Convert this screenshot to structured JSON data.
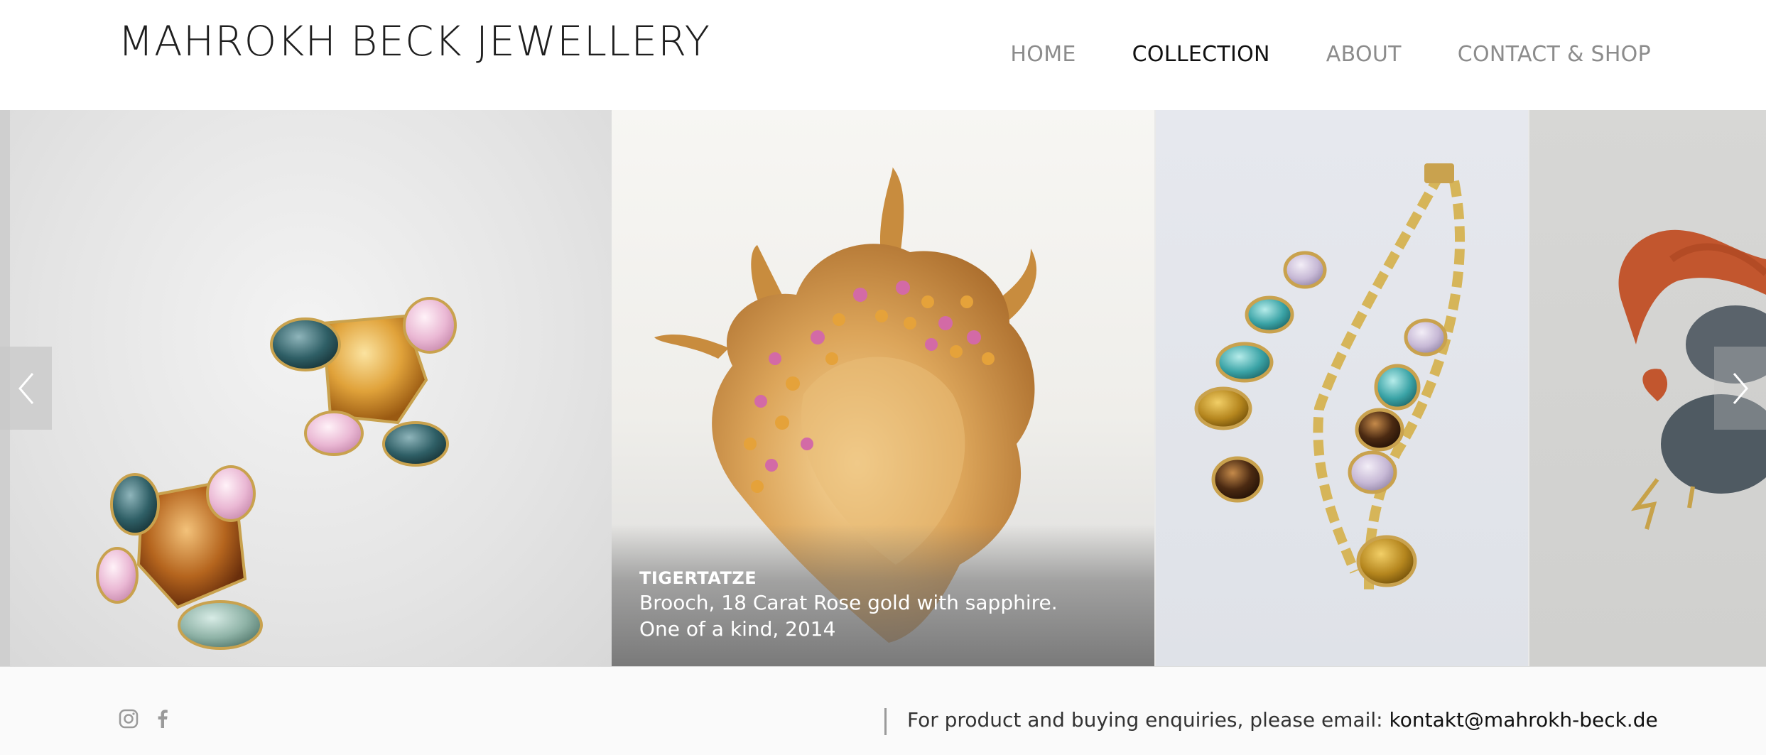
{
  "header": {
    "brand": "MAHROKH BECK JEWELLERY",
    "nav": [
      {
        "label": "HOME",
        "active": false
      },
      {
        "label": "COLLECTION",
        "active": true
      },
      {
        "label": "ABOUT",
        "active": false
      },
      {
        "label": "CONTACT & SHOP",
        "active": false
      }
    ]
  },
  "gallery": {
    "caption": {
      "title": "TIGERTATZE",
      "line1": "Brooch, 18 Carat Rose gold with sapphire.",
      "line2": "One of a kind, 2014"
    },
    "prev_icon": "chevron-left-icon",
    "next_icon": "chevron-right-icon"
  },
  "footer": {
    "social_icons": [
      "instagram-icon",
      "facebook-icon"
    ],
    "enquiry_text": "For product and buying enquiries, please email: ",
    "email": "kontakt@mahrokh-beck.de"
  },
  "colors": {
    "nav_inactive": "#8c8c8c",
    "nav_active": "#111111",
    "gold": "#d7a44d"
  }
}
